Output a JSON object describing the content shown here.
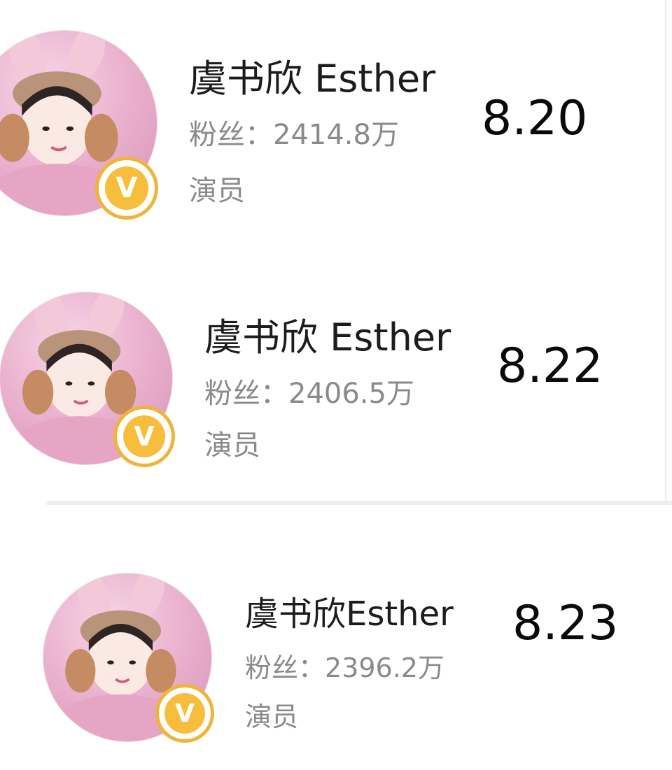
{
  "cards": [
    {
      "name": "虞书欣 Esther",
      "fans_label": "粉丝：",
      "fans_value": "2414.8万",
      "role": "演员",
      "date": "8.20"
    },
    {
      "name": "虞书欣 Esther",
      "fans_label": "粉丝：",
      "fans_value": "2406.5万",
      "role": "演员",
      "date": "8.22"
    },
    {
      "name": "虞书欣Esther",
      "fans_label": "粉丝：",
      "fans_value": "2396.2万",
      "role": "演员",
      "date": "8.23"
    }
  ],
  "badge": {
    "letter": "V",
    "icon": "verified-v-badge-icon",
    "color": "#f0b43a"
  },
  "colors": {
    "name": "#1c1c1c",
    "muted": "#8a8a8a",
    "date": "#0a0a0a"
  }
}
